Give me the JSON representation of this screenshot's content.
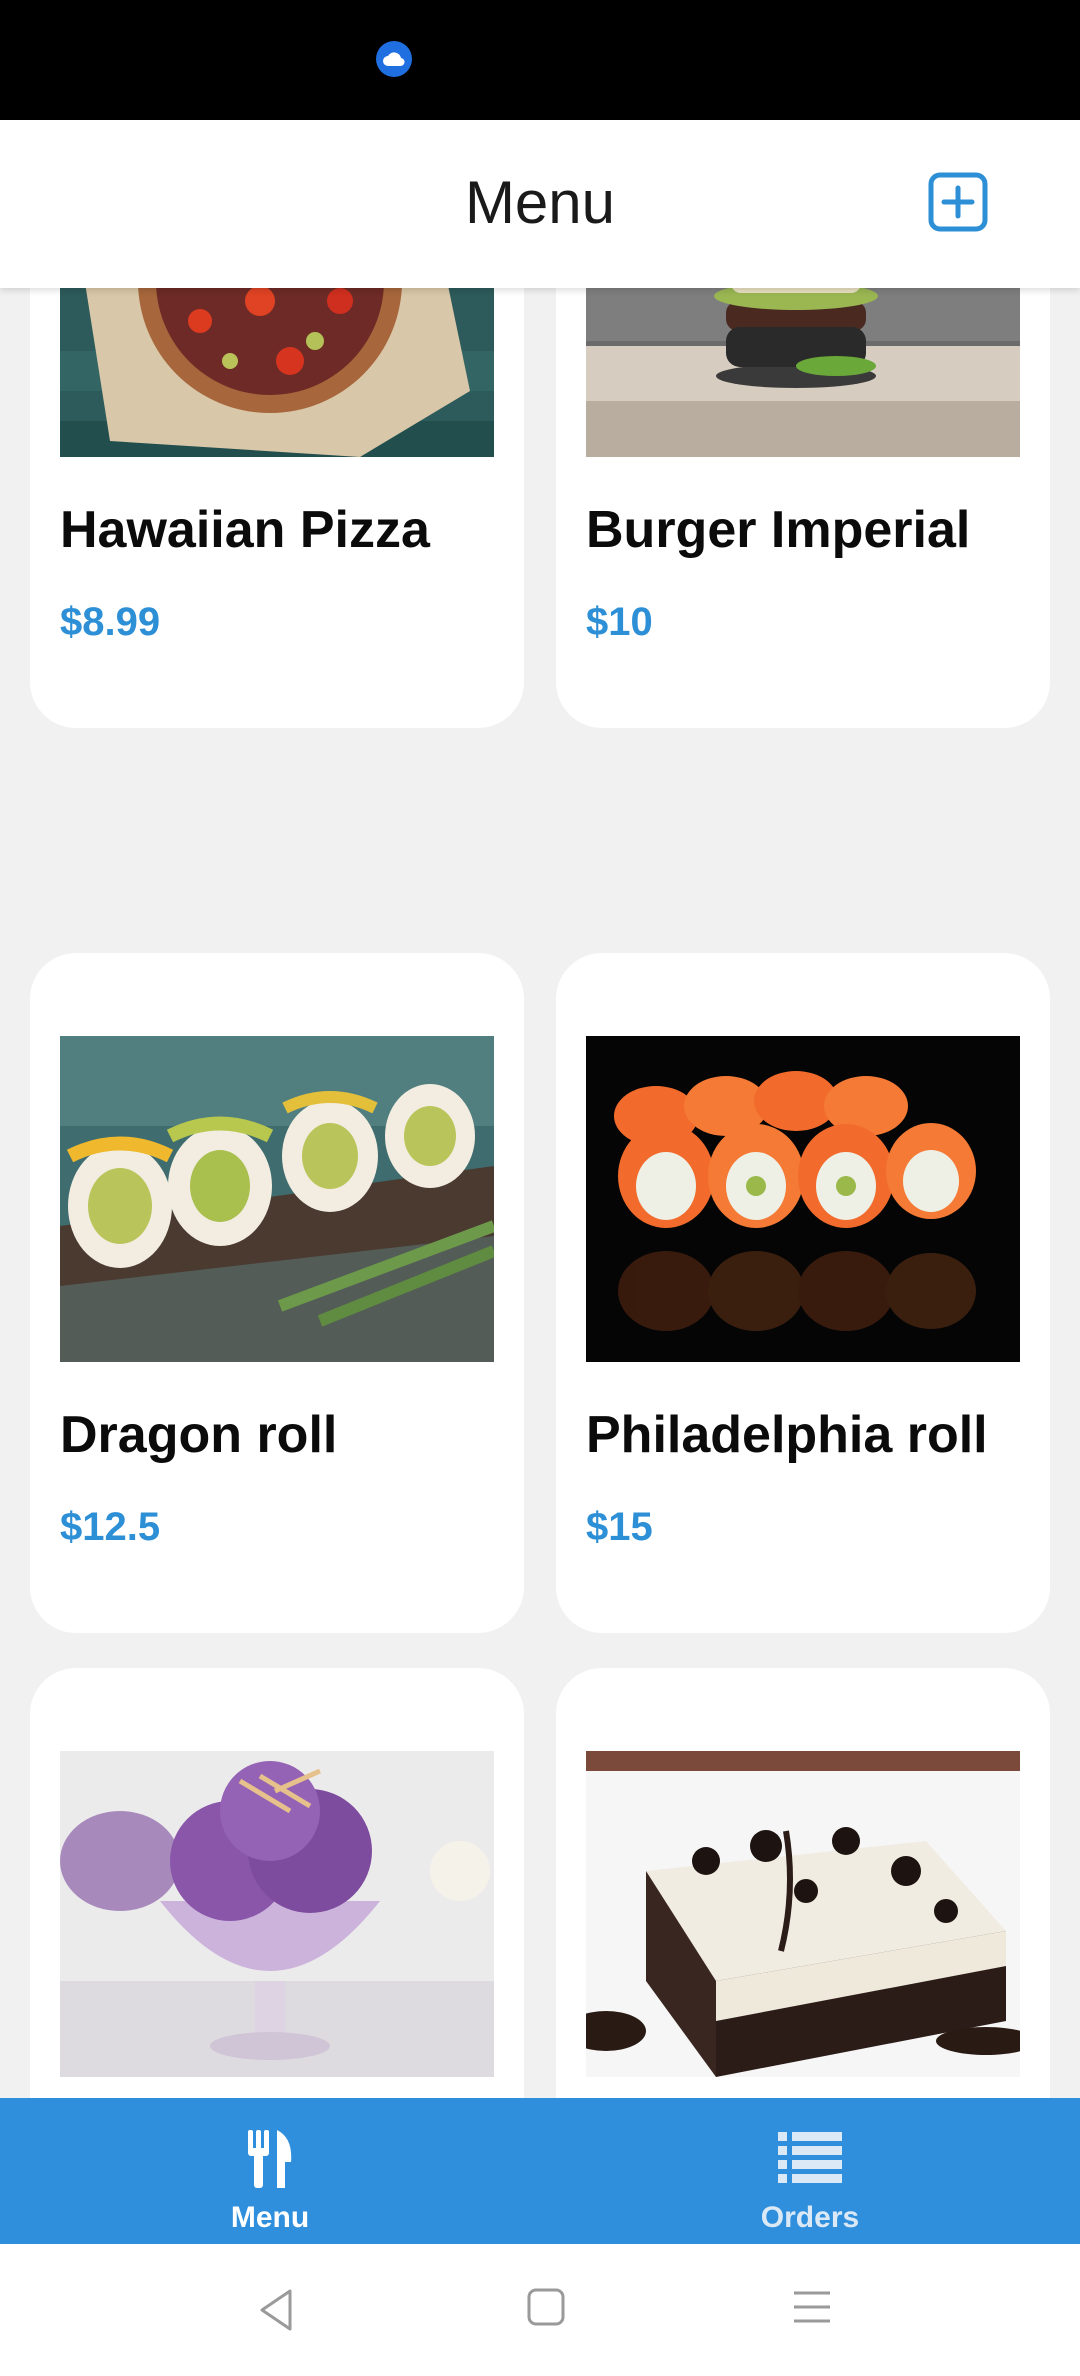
{
  "status_bar": {
    "icon": "cloud-icon"
  },
  "header": {
    "title": "Menu",
    "add_icon": "add-square-icon"
  },
  "menu_items": [
    {
      "name": "Hawaiian Pizza",
      "price": "$8.99",
      "image": "pizza-photo"
    },
    {
      "name": "Burger Imperial",
      "price": "$10",
      "image": "burger-photo"
    },
    {
      "name": "Dragon roll",
      "price": "$12.5",
      "image": "dragon-roll-photo"
    },
    {
      "name": "Philadelphia roll",
      "price": "$15",
      "image": "philadelphia-roll-photo"
    },
    {
      "name": "",
      "price": "",
      "image": "ube-ice-cream-photo"
    },
    {
      "name": "",
      "price": "",
      "image": "oreo-cake-photo"
    }
  ],
  "bottom_nav": {
    "items": [
      {
        "label": "Menu",
        "icon": "fork-knife-icon",
        "active": true
      },
      {
        "label": "Orders",
        "icon": "list-icon",
        "active": false
      }
    ]
  },
  "system_nav": {
    "back": "back-icon",
    "home": "home-icon",
    "recents": "recents-icon"
  },
  "colors": {
    "accent": "#2d8fd6",
    "nav_bg": "#2f8fdc",
    "background": "#f1f1f1"
  }
}
